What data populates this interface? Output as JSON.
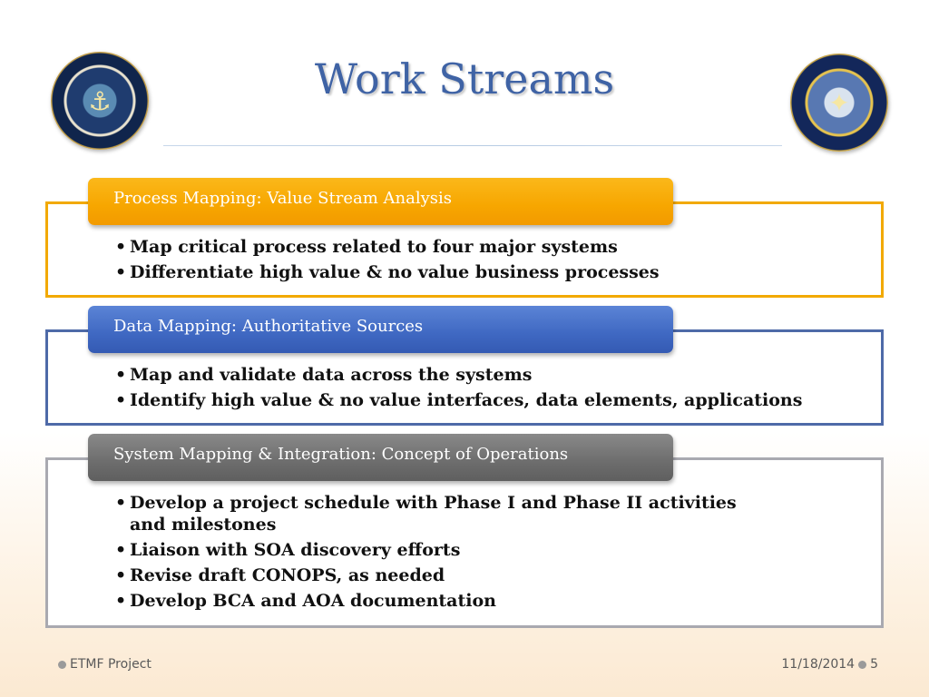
{
  "slide": {
    "title": "Work Streams",
    "logo_left_icon": "naval-education-and-training-command-seal-icon",
    "logo_right_icon": "professional-development-and-technology-center-seal-icon"
  },
  "sections": [
    {
      "header": "Process Mapping: Value Stream Analysis",
      "color": "#f7a600",
      "bullets": [
        "Map critical process related to four major systems",
        "Differentiate high value & no value business processes"
      ]
    },
    {
      "header": "Data Mapping: Authoritative Sources",
      "color": "#3f68c2",
      "bullets": [
        "Map and validate data across the systems",
        "Identify high value & no value interfaces, data elements, applications"
      ]
    },
    {
      "header": "System Mapping & Integration: Concept of Operations",
      "color": "#6d6d6d",
      "bullets": [
        "Develop a project schedule with Phase I and Phase II activities and milestones",
        "Liaison with SOA discovery efforts",
        "Revise draft CONOPS, as needed",
        "Develop BCA and AOA documentation"
      ]
    }
  ],
  "footer": {
    "project": "ETMF Project",
    "date": "11/18/2014",
    "page": "5"
  }
}
